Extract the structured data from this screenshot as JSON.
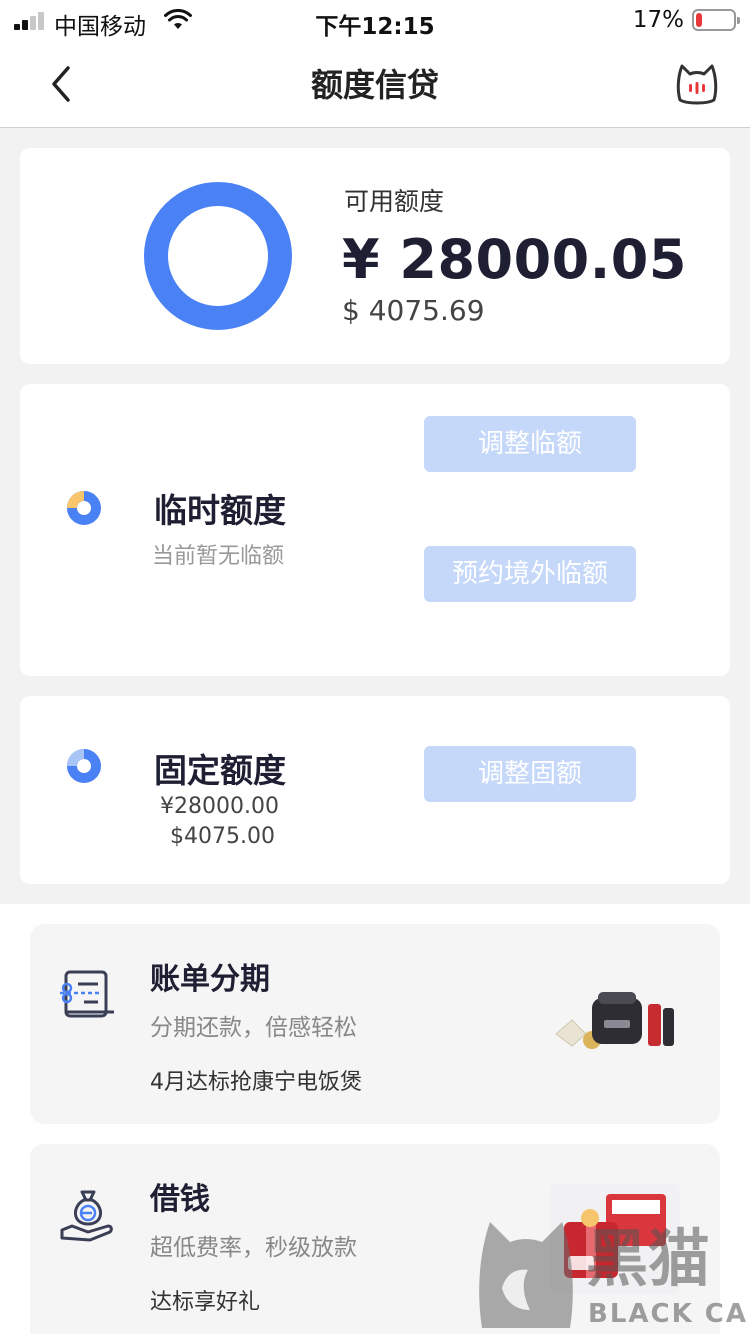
{
  "status_bar": {
    "carrier": "中国移动",
    "time": "下午12:15",
    "battery_percent": "17%",
    "battery_level": 0.17,
    "battery_color": "#e8383a"
  },
  "nav": {
    "title": "额度信贷",
    "back_icon": "chevron-left-icon",
    "service_icon": "cat-service-icon"
  },
  "available": {
    "label": "可用额度",
    "amount_cny": "¥ 28000.05",
    "amount_usd": "$ 4075.69",
    "ring_color": "#4a82f6"
  },
  "temporary": {
    "title": "临时额度",
    "subtitle": "当前暂无临额",
    "adjust_button": "调整临额",
    "overseas_button": "预约境外临额"
  },
  "fixed": {
    "title": "固定额度",
    "amount_cny": "¥28000.00",
    "amount_usd": "$4075.00",
    "adjust_button": "调整固额"
  },
  "promos": {
    "installment": {
      "title": "账单分期",
      "subtitle": "分期还款，倍感轻松",
      "note": "4月达标抢康宁电饭煲",
      "icon": "bill-scissors-icon"
    },
    "loan": {
      "title": "借钱",
      "subtitle": "超低费率，秒级放款",
      "note": "达标享好礼",
      "icon": "money-bag-hand-icon"
    }
  },
  "watermark": {
    "text_cn": "黑猫",
    "text_en": "BLACK CAT"
  },
  "colors": {
    "accent": "#4a82f6",
    "button_bg": "#c5d8fa",
    "temp_donut_segment": "#f7c56b"
  }
}
